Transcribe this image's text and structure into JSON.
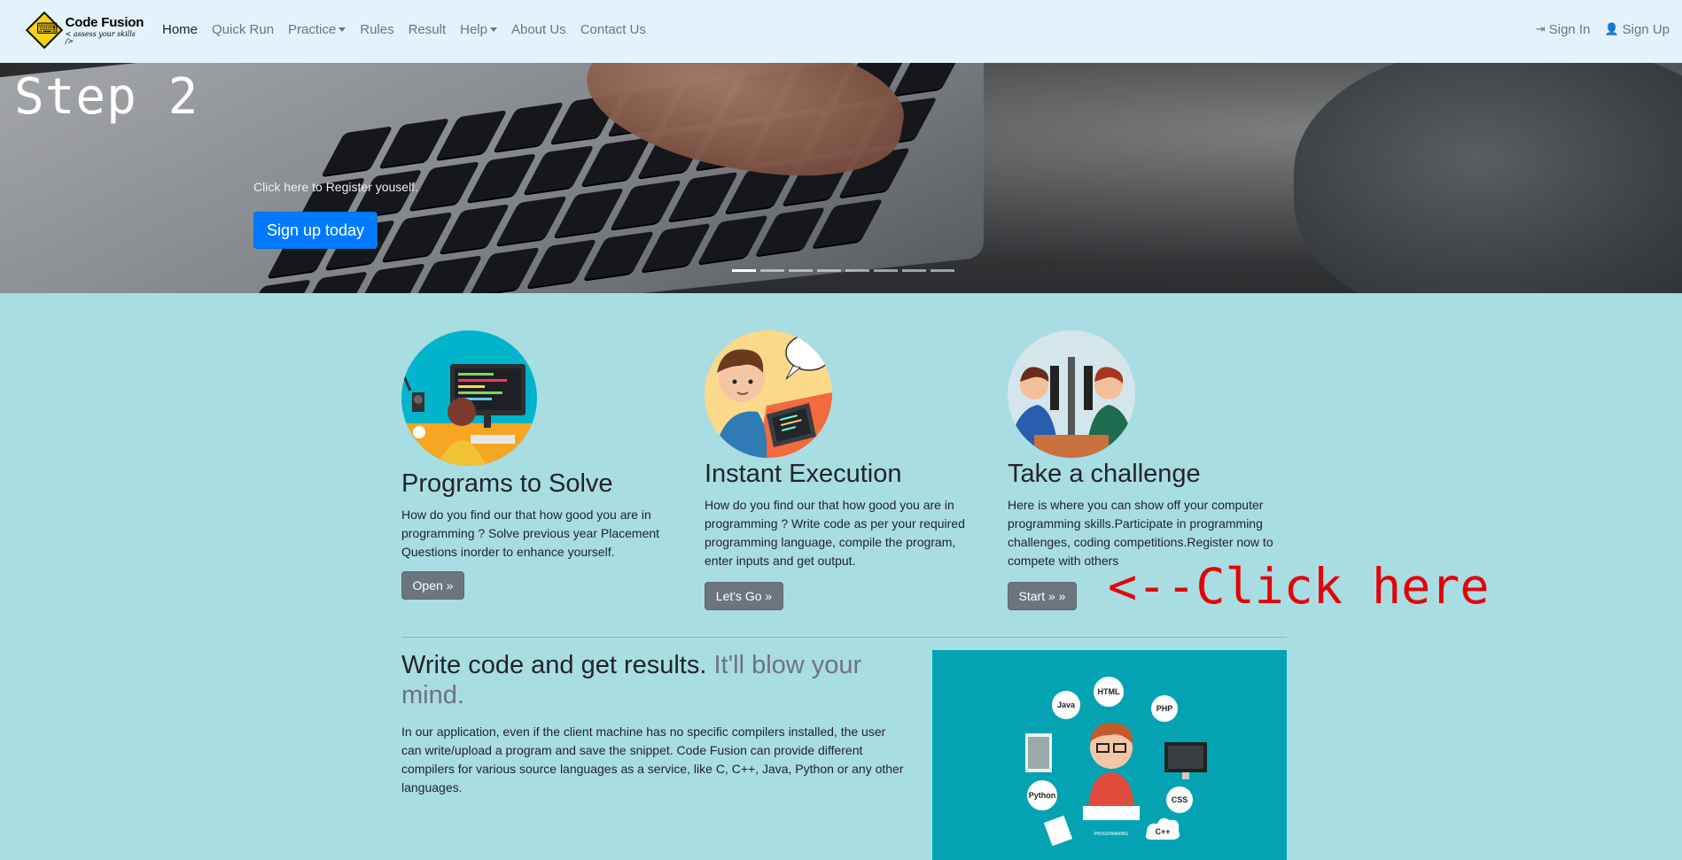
{
  "nav": {
    "brand_title": "Code Fusion",
    "brand_subtitle": "< assess your skills />",
    "links": [
      {
        "label": "Home",
        "active": true,
        "dropdown": false
      },
      {
        "label": "Quick Run",
        "active": false,
        "dropdown": false
      },
      {
        "label": "Practice",
        "active": false,
        "dropdown": true
      },
      {
        "label": "Rules",
        "active": false,
        "dropdown": false
      },
      {
        "label": "Result",
        "active": false,
        "dropdown": false
      },
      {
        "label": "Help",
        "active": false,
        "dropdown": true
      },
      {
        "label": "About Us",
        "active": false,
        "dropdown": false
      },
      {
        "label": "Contact Us",
        "active": false,
        "dropdown": false
      }
    ],
    "sign_in": "Sign In",
    "sign_up": "Sign Up"
  },
  "hero": {
    "step_label": "Step 2",
    "caption": "Click here to Register youself.",
    "button": "Sign up today",
    "slide_count": 8,
    "active_slide": 1
  },
  "features": [
    {
      "title": "Programs to Solve",
      "text": "How do you find our that how good you are in programming ? Solve previous year Placement Questions inorder to enhance yourself.",
      "button": "Open »"
    },
    {
      "title": "Instant Execution",
      "text": "How do you find our that how good you are in programming ? Write code as per your required programming language, compile the program, enter inputs and get output.",
      "button": "Let's Go »"
    },
    {
      "title": "Take a challenge",
      "text": "Here is where you can show off your computer programming skills.Participate in programming challenges, coding competitions.Register now to compete with others",
      "button": "Start » »"
    }
  ],
  "annotation": "<--Click here",
  "featurette": {
    "heading": "Write code and get results.",
    "heading_muted": "It'll blow your mind.",
    "text": "In our application, even if the client machine has no specific compilers installed, the user can write/upload a program and save the snippet. Code Fusion can provide different compilers for various source languages as a service, like C, C++, Java, Python or any other languages.",
    "image_labels": [
      "Java",
      "HTML",
      "PHP",
      "Python",
      "CSS",
      "C++",
      "PROGRAMMING"
    ]
  }
}
